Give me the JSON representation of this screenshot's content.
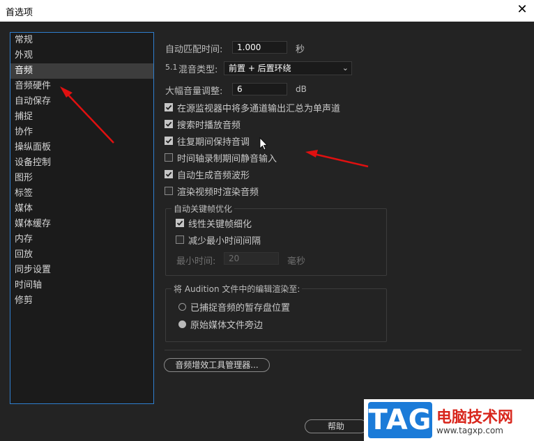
{
  "window": {
    "title": "首选项",
    "close_glyph": "✕"
  },
  "sidebar": {
    "items": [
      "常规",
      "外观",
      "音频",
      "音频硬件",
      "自动保存",
      "捕捉",
      "协作",
      "操纵面板",
      "设备控制",
      "图形",
      "标签",
      "媒体",
      "媒体缓存",
      "内存",
      "回放",
      "同步设置",
      "时间轴",
      "修剪"
    ],
    "active_index": 2
  },
  "audio": {
    "auto_match_time_label": "自动匹配时间:",
    "auto_match_time_value": "1.000",
    "auto_match_time_unit": "秒",
    "mix_type_prefix": "5.1",
    "mix_type_label": "混音类型:",
    "mix_type_value": "前置 + 后置环绕",
    "large_volume_label": "大幅音量调整:",
    "large_volume_value": "6",
    "large_volume_unit": "dB",
    "checkboxes": [
      {
        "label": "在源监视器中将多通道输出汇总为单声道",
        "checked": true
      },
      {
        "label": "搜索时播放音频",
        "checked": true
      },
      {
        "label": "往复期间保持音调",
        "checked": true
      },
      {
        "label": "时间轴录制期间静音输入",
        "checked": false
      },
      {
        "label": "自动生成音频波形",
        "checked": true
      },
      {
        "label": "渲染视频时渲染音频",
        "checked": false
      }
    ],
    "keyframe_group": {
      "title": "自动关键帧优化",
      "linear_label": "线性关键帧细化",
      "linear_checked": true,
      "reduce_label": "减少最小时间间隔",
      "reduce_checked": false,
      "min_time_label": "最小时间:",
      "min_time_value": "20",
      "min_time_unit": "毫秒"
    },
    "audition_group": {
      "title": "将 Audition 文件中的编辑渲染至:",
      "option1": "已捕捉音频的暂存盘位置",
      "option2": "原始媒体文件旁边",
      "selected": 2
    },
    "plugin_manager_label": "音频增效工具管理器..."
  },
  "footer": {
    "help_label": "帮助"
  },
  "watermark": {
    "tag": "TAG",
    "name": "电脑技术网",
    "url": "www.tagxp.com"
  },
  "colors": {
    "accent_border": "#2f7fcf",
    "arrow": "#e01010",
    "watermark_blue": "#1b7bd8",
    "watermark_red": "#d8261c"
  }
}
